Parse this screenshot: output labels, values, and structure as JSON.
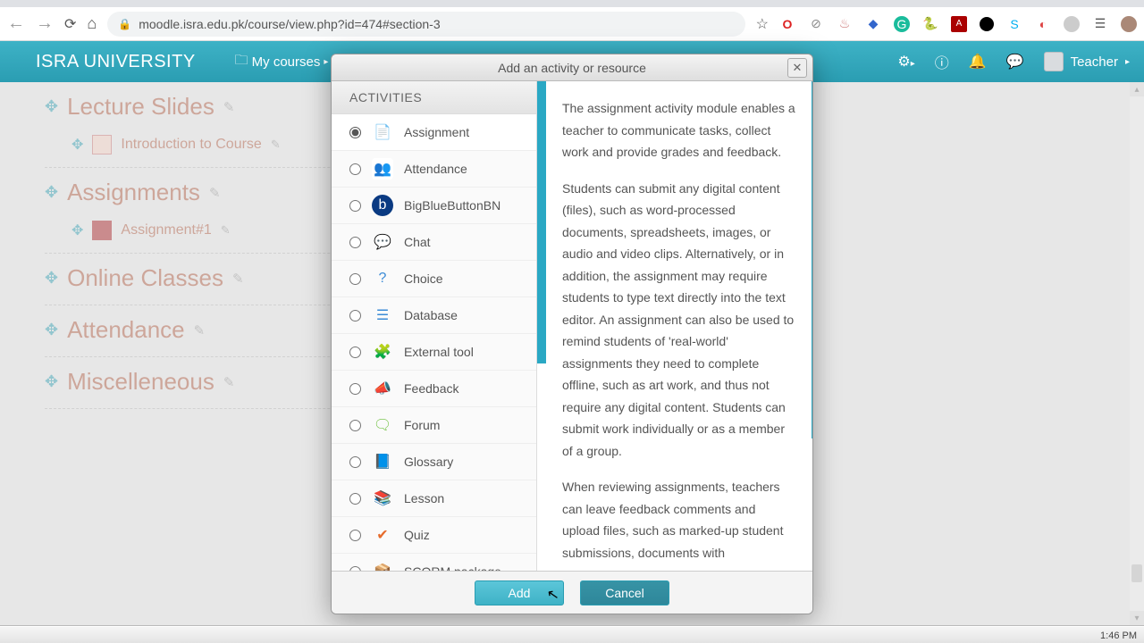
{
  "browser": {
    "url": "moodle.isra.edu.pk/course/view.php?id=474#section-3"
  },
  "moodle": {
    "brand": "ISRA UNIVERSITY",
    "my_courses": "My courses",
    "user_name": "Teacher"
  },
  "sections": [
    {
      "title": "Lecture Slides",
      "child": "Introduction to Course",
      "child_icon": "ppt"
    },
    {
      "title": "Assignments",
      "child": "Assignment#1",
      "child_icon": "pdf"
    },
    {
      "title": "Online Classes"
    },
    {
      "title": "Attendance"
    },
    {
      "title": "Miscelleneous"
    }
  ],
  "modal": {
    "title": "Add an activity or resource",
    "list_heading": "ACTIVITIES",
    "add_label": "Add",
    "cancel_label": "Cancel",
    "activities": [
      {
        "name": "Assignment",
        "icon": "ic-assign",
        "glyph": "📄",
        "selected": true
      },
      {
        "name": "Attendance",
        "icon": "ic-attend",
        "glyph": "👥"
      },
      {
        "name": "BigBlueButtonBN",
        "icon": "ic-bbb",
        "glyph": "b"
      },
      {
        "name": "Chat",
        "icon": "ic-chat",
        "glyph": "💬"
      },
      {
        "name": "Choice",
        "icon": "ic-choice",
        "glyph": "?"
      },
      {
        "name": "Database",
        "icon": "ic-db",
        "glyph": "☰"
      },
      {
        "name": "External tool",
        "icon": "ic-ext",
        "glyph": "🧩"
      },
      {
        "name": "Feedback",
        "icon": "ic-feed",
        "glyph": "📣"
      },
      {
        "name": "Forum",
        "icon": "ic-forum",
        "glyph": "🗨"
      },
      {
        "name": "Glossary",
        "icon": "ic-gloss",
        "glyph": "📘"
      },
      {
        "name": "Lesson",
        "icon": "ic-lesson",
        "glyph": "📚"
      },
      {
        "name": "Quiz",
        "icon": "ic-quiz",
        "glyph": "✔"
      },
      {
        "name": "SCORM package",
        "icon": "ic-scorm",
        "glyph": "📦"
      }
    ],
    "description": {
      "p1": "The assignment activity module enables a teacher to communicate tasks, collect work and provide grades and feedback.",
      "p2": "Students can submit any digital content (files), such as word-processed documents, spreadsheets, images, or audio and video clips. Alternatively, or in addition, the assignment may require students to type text directly into the text editor. An assignment can also be used to remind students of 'real-world' assignments they need to complete offline, such as art work, and thus not require any digital content. Students can submit work individually or as a member of a group.",
      "p3": "When reviewing assignments, teachers can leave feedback comments and upload files, such as marked-up student submissions, documents with"
    }
  },
  "clock": {
    "time": "1:46 PM"
  }
}
